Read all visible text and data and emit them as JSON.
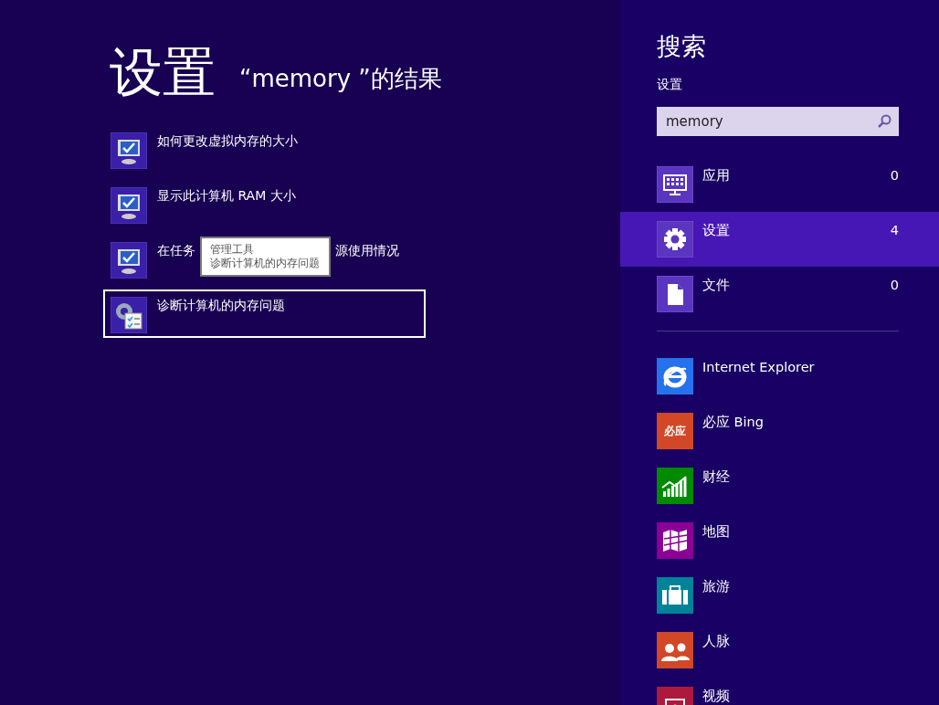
{
  "results_pane": {
    "title": "设置",
    "query_heading": "“memory ”的结果",
    "results": [
      {
        "kind": "monitor",
        "label_parts": [
          "如何更改虚拟内存的大小"
        ],
        "selected": false
      },
      {
        "kind": "monitor",
        "label_parts": [
          "显示此计算机 RAM 大小"
        ],
        "selected": false
      },
      {
        "kind": "monitor",
        "label_parts": [
          "在任务",
          "源使用情况"
        ],
        "selected": false
      },
      {
        "kind": "tools",
        "label_parts": [
          "诊断计算机的内存问题"
        ],
        "selected": true
      }
    ],
    "tooltip": {
      "lines": [
        "管理工具",
        "诊断计算机的内存问题"
      ]
    }
  },
  "search_pane": {
    "title": "搜索",
    "scope": "设置",
    "search": {
      "value": "memory"
    },
    "categories": [
      {
        "kind": "apps",
        "label": "应用",
        "count": "0",
        "selected": false
      },
      {
        "kind": "settings",
        "label": "设置",
        "count": "4",
        "selected": true
      },
      {
        "kind": "files",
        "label": "文件",
        "count": "0",
        "selected": false
      }
    ],
    "apps": [
      {
        "kind": "ie",
        "label": "Internet Explorer",
        "color": "#2672ec"
      },
      {
        "kind": "bing",
        "label": "必应 Bing",
        "color": "#d24726",
        "icon_text": "必应"
      },
      {
        "kind": "finance",
        "label": "财经",
        "color": "#008a00"
      },
      {
        "kind": "maps",
        "label": "地图",
        "color": "#8c0095"
      },
      {
        "kind": "travel",
        "label": "旅游",
        "color": "#008299"
      },
      {
        "kind": "people",
        "label": "人脉",
        "color": "#d24726"
      },
      {
        "kind": "video",
        "label": "视频",
        "color": "#ac193d"
      }
    ]
  }
}
